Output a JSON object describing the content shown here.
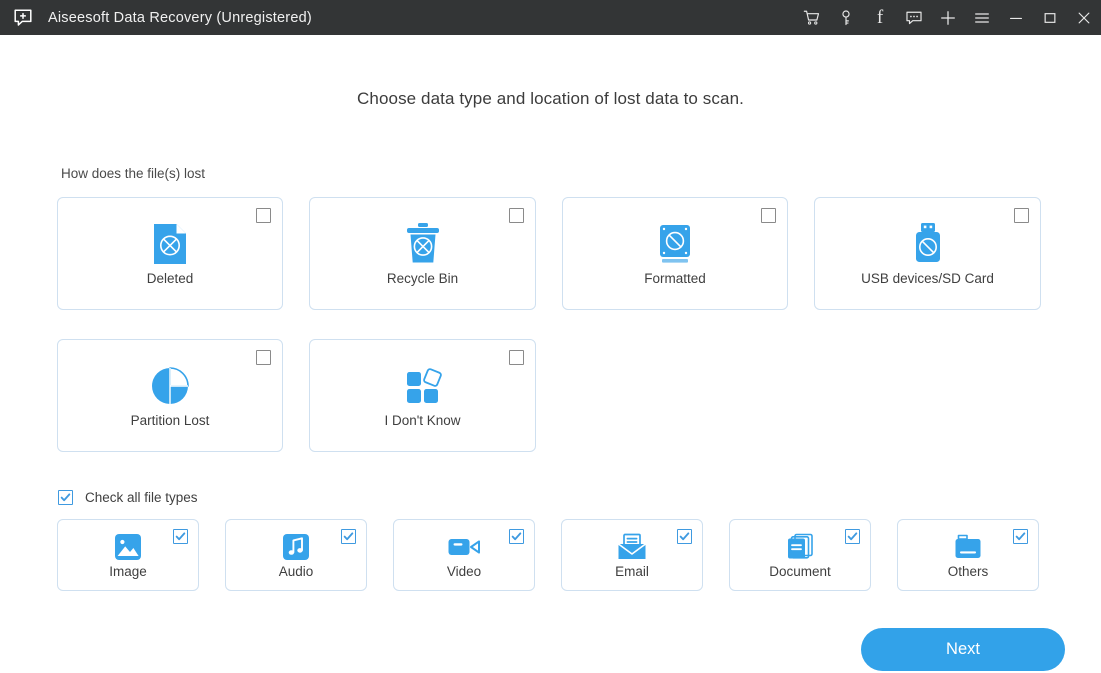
{
  "window": {
    "title": "Aiseesoft Data Recovery (Unregistered)",
    "logo_icon": "app-plus-icon",
    "controls": [
      {
        "name": "cart-icon",
        "label": "Buy"
      },
      {
        "name": "key-icon",
        "label": "Register"
      },
      {
        "name": "facebook-icon",
        "label": "f"
      },
      {
        "name": "feedback-icon",
        "label": "Feedback"
      },
      {
        "name": "plus-icon",
        "label": "More"
      },
      {
        "name": "menu-icon",
        "label": "Menu"
      },
      {
        "name": "minimize-icon",
        "label": "Minimize"
      },
      {
        "name": "maximize-icon",
        "label": "Maximize"
      },
      {
        "name": "close-icon",
        "label": "Close"
      }
    ]
  },
  "main": {
    "heading": "Choose data type and location of lost data to scan.",
    "section_label": "How does the file(s) lost",
    "reasons": [
      {
        "label": "Deleted",
        "icon": "deleted-file-icon",
        "checked": false
      },
      {
        "label": "Recycle Bin",
        "icon": "recycle-bin-icon",
        "checked": false
      },
      {
        "label": "Formatted",
        "icon": "formatted-disk-icon",
        "checked": false
      },
      {
        "label": "USB devices/SD Card",
        "icon": "usb-drive-icon",
        "checked": false
      },
      {
        "label": "Partition Lost",
        "icon": "partition-pie-icon",
        "checked": false
      },
      {
        "label": "I Don't Know",
        "icon": "unknown-blocks-icon",
        "checked": false
      }
    ],
    "check_all": {
      "label": "Check all file types",
      "checked": true
    },
    "file_types": [
      {
        "label": "Image",
        "icon": "image-icon",
        "checked": true
      },
      {
        "label": "Audio",
        "icon": "audio-icon",
        "checked": true
      },
      {
        "label": "Video",
        "icon": "video-icon",
        "checked": true
      },
      {
        "label": "Email",
        "icon": "email-icon",
        "checked": true
      },
      {
        "label": "Document",
        "icon": "document-icon",
        "checked": true
      },
      {
        "label": "Others",
        "icon": "others-icon",
        "checked": true
      }
    ],
    "next_label": "Next"
  },
  "colors": {
    "titlebar": "#333536",
    "accent": "#32a2e9",
    "card_border": "#cfe0f0",
    "text": "#3f3f3f"
  }
}
